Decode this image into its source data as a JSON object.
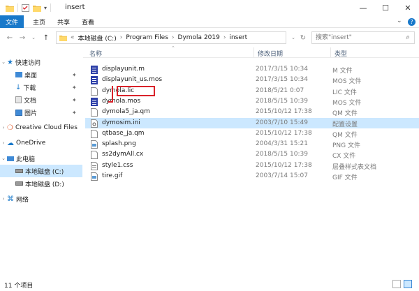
{
  "window": {
    "title": "insert"
  },
  "ribbon": {
    "file_tab": "文件",
    "tabs": [
      "主页",
      "共享",
      "查看"
    ]
  },
  "address": {
    "crumbs": [
      "本地磁盘 (C:)",
      "Program Files",
      "Dymola 2019",
      "insert"
    ],
    "search_placeholder": "搜索\"insert\""
  },
  "sidebar": {
    "quick_access": "快速访问",
    "quick_items": [
      "桌面",
      "下载",
      "文档",
      "图片"
    ],
    "creative_cloud": "Creative Cloud Files",
    "onedrive": "OneDrive",
    "this_pc": "此电脑",
    "drives": [
      "本地磁盘 (C:)",
      "本地磁盘 (D:)"
    ],
    "network": "网络"
  },
  "columns": {
    "name": "名称",
    "date": "修改日期",
    "type": "类型"
  },
  "files": [
    {
      "name": "displayunit.m",
      "date": "2017/3/15 10:34",
      "type": "M 文件",
      "icon": "script-icon"
    },
    {
      "name": "displayunit_us.mos",
      "date": "2017/3/15 10:34",
      "type": "MOS 文件",
      "icon": "script-icon"
    },
    {
      "name": "dymola.lic",
      "date": "2018/5/21 0:07",
      "type": "LIC 文件",
      "icon": "blank-file-icon"
    },
    {
      "name": "dymola.mos",
      "date": "2018/5/15 10:39",
      "type": "MOS 文件",
      "icon": "script-icon"
    },
    {
      "name": "dymola5_ja.qm",
      "date": "2015/10/12 17:38",
      "type": "QM 文件",
      "icon": "blank-file-icon"
    },
    {
      "name": "dymosim.ini",
      "date": "2003/7/10 15:49",
      "type": "配置设置",
      "icon": "settings-file-icon",
      "selected": true
    },
    {
      "name": "qtbase_ja.qm",
      "date": "2015/10/12 17:38",
      "type": "QM 文件",
      "icon": "blank-file-icon"
    },
    {
      "name": "splash.png",
      "date": "2004/3/31 15:21",
      "type": "PNG 文件",
      "icon": "image-file-icon"
    },
    {
      "name": "ss2dymAll.cx",
      "date": "2018/5/15 10:39",
      "type": "CX 文件",
      "icon": "blank-file-icon"
    },
    {
      "name": "style1.css",
      "date": "2015/10/12 17:38",
      "type": "层叠样式表文档",
      "icon": "css-file-icon"
    },
    {
      "name": "tire.gif",
      "date": "2003/7/14 15:07",
      "type": "GIF 文件",
      "icon": "image-file-icon"
    }
  ],
  "status": {
    "count": "11 个项目"
  },
  "colors": {
    "accent": "#1979ca",
    "selection": "#cce8ff",
    "highlight_box": "#d9222a"
  }
}
